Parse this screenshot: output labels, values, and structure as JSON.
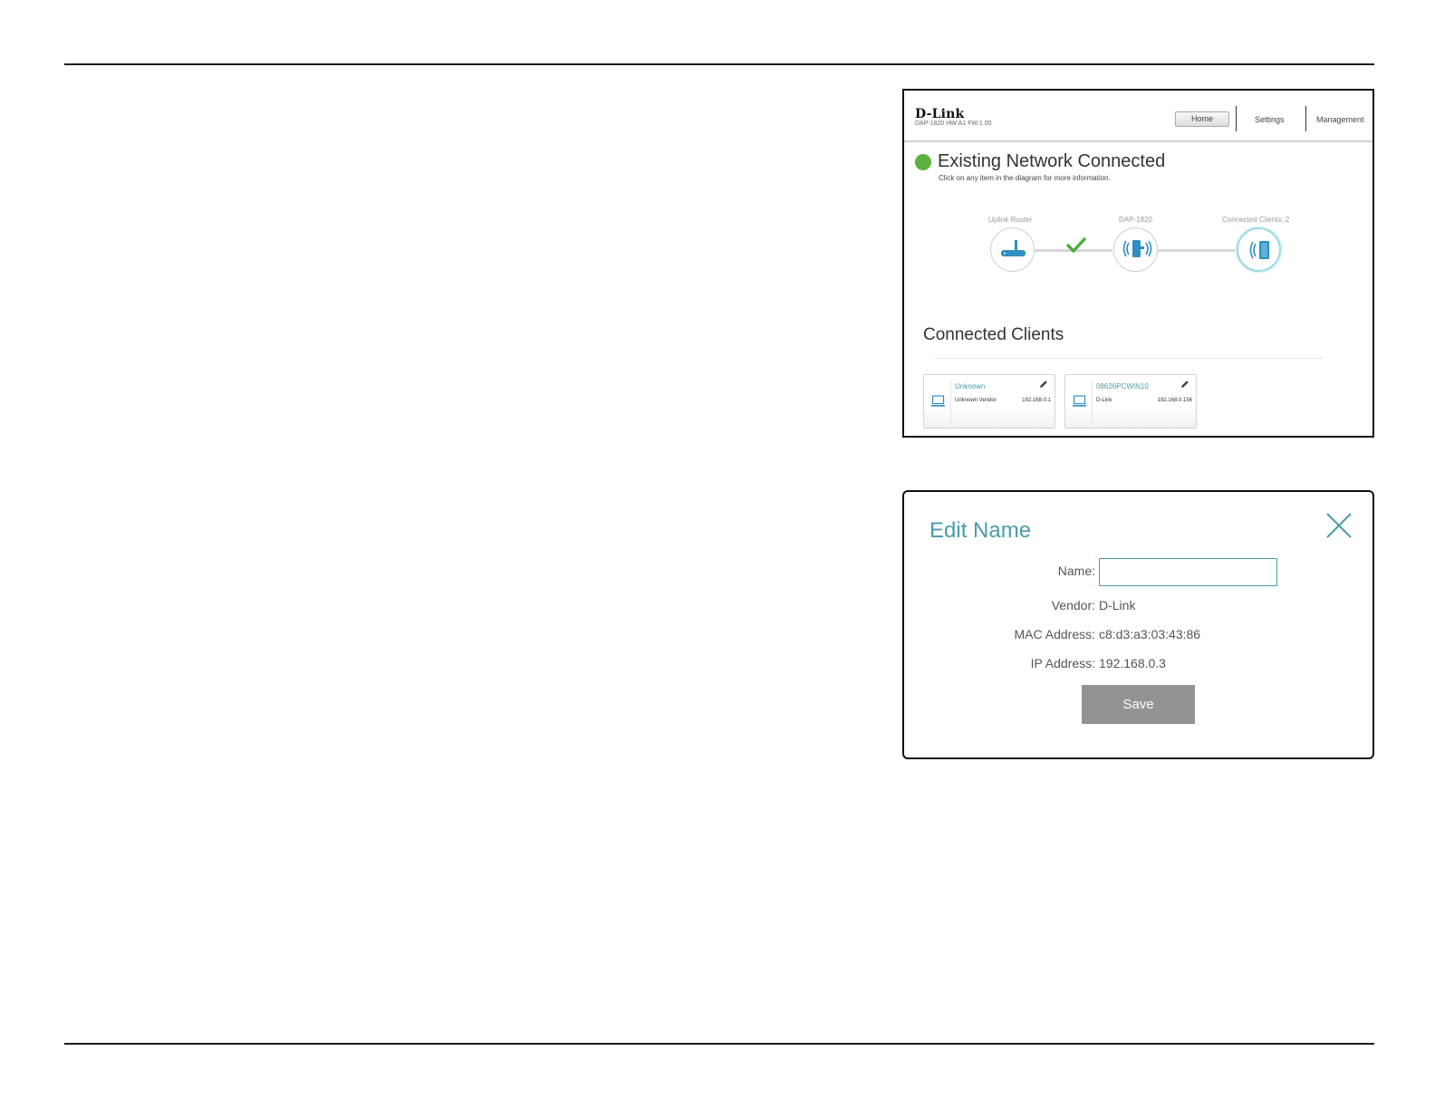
{
  "home": {
    "logo": "D-Link",
    "model_line": "DAP-1820  HW:A1  FW:1.00",
    "nav": {
      "home": "Home",
      "settings": "Settings",
      "management": "Management"
    },
    "status_title": "Existing Network Connected",
    "status_subtitle": "Click on any item in the diagram for more information.",
    "diagram": {
      "uplink_label": "Uplink Router",
      "device_label": "DAP-1820",
      "clients_label": "Connected Clients: 2"
    },
    "connected_clients_title": "Connected Clients",
    "clients": [
      {
        "name": "Unknown",
        "vendor": "Unknown Vendor",
        "ip": "192.168.0.1"
      },
      {
        "name": "08626PCWIN10",
        "vendor": "D-Link",
        "ip": "192.168.0.156"
      }
    ],
    "colors": {
      "status": "#5db13f",
      "accent": "#4a9ca6"
    }
  },
  "dialog": {
    "title": "Edit Name",
    "name_label": "Name:",
    "name_value": "",
    "vendor_label": "Vendor:",
    "vendor_value": "D-Link",
    "mac_label": "MAC Address:",
    "mac_value": "c8:d3:a3:03:43:86",
    "ip_label": "IP Address:",
    "ip_value": "192.168.0.3",
    "save_label": "Save",
    "colors": {
      "title": "#4a9ca6",
      "button": "#939393"
    }
  }
}
